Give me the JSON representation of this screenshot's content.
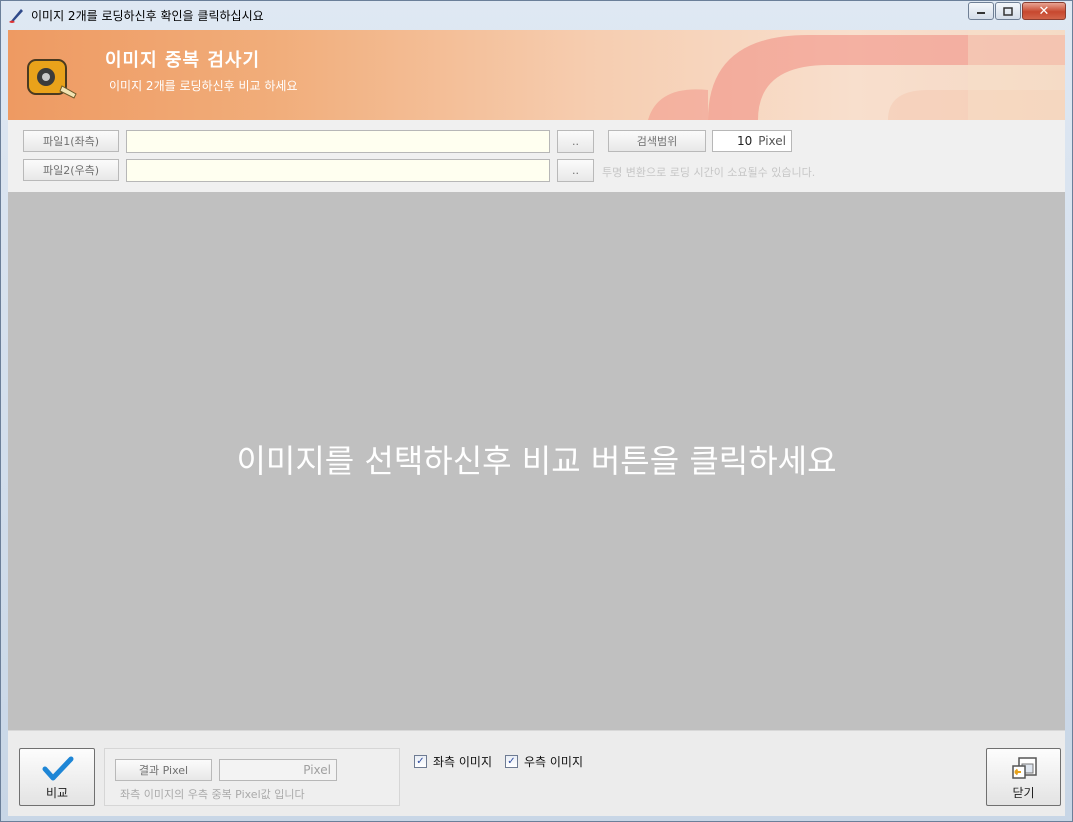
{
  "window": {
    "title": "이미지 2개를 로딩하신후 확인을 클릭하십시요",
    "icons": [
      "app-icon",
      "minimize-icon",
      "maximize-icon",
      "close-icon"
    ]
  },
  "banner": {
    "title": "이미지 중복 검사기",
    "subtitle": "이미지 2개를 로딩하신후 비교 하세요",
    "icon": "tape-measure-icon"
  },
  "controls": {
    "file1_label": "파일1(좌측)",
    "file1_value": "",
    "file2_label": "파일2(우측)",
    "file2_value": "",
    "browse_label": "..",
    "search_range_label": "검색범위",
    "search_range_value": "10",
    "search_range_unit": "Pixel",
    "transparency_hint": "투명 변환으로 로딩 시간이 소요될수 있습니다."
  },
  "canvas": {
    "message": "이미지를 선택하신후 비교 버튼을 클릭하세요"
  },
  "bottom": {
    "compare_label": "비교",
    "compare_icon": "checkmark-icon",
    "result_label": "결과 Pixel",
    "result_value": "",
    "result_unit": "Pixel",
    "result_note": "좌측 이미지의 우측 중복 Pixel값 입니다",
    "left_image_label": "좌측 이미지",
    "left_image_checked": true,
    "right_image_label": "우측 이미지",
    "right_image_checked": true,
    "close_label": "닫기",
    "close_icon": "exit-window-icon"
  },
  "colors": {
    "banner_start": "#ee9a62",
    "banner_end": "#f5d8c5",
    "field_bg": "#fffff0",
    "canvas_bg": "#c0c0c0",
    "canvas_text": "#ffffff"
  }
}
